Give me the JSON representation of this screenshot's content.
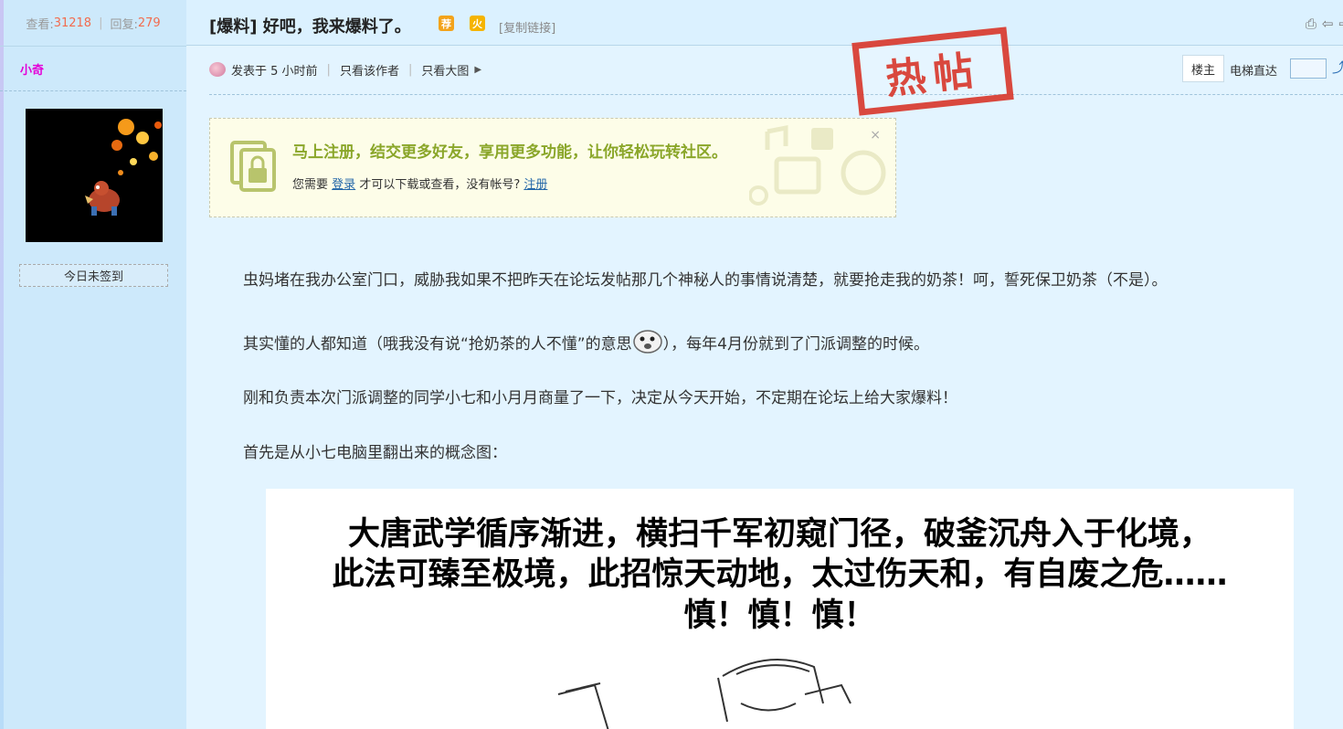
{
  "stats": {
    "views_label": "查看:",
    "views": "31218",
    "replies_label": "回复:",
    "replies": "279"
  },
  "user": {
    "name": "小奇",
    "checkin_label": "今日未签到"
  },
  "thread": {
    "tag": "[爆料]",
    "title": "好吧，我来爆料了。",
    "badge_recommend": "荐",
    "badge_hot": "火",
    "copy_link": "[复制链接]",
    "stamp": "热帖"
  },
  "meta": {
    "posted": "发表于 5 小时前",
    "only_author": "只看该作者",
    "only_big_image": "只看大图",
    "floor": "楼主",
    "jump_label": "电梯直达"
  },
  "register_box": {
    "headline": "马上注册，结交更多好友，享用更多功能，让你轻松玩转社区。",
    "sub_prefix": "您需要",
    "login": "登录",
    "sub_middle": "才可以下载或查看，没有帐号?",
    "register": "注册",
    "close": "×"
  },
  "post": {
    "p1": "虫妈堵在我办公室门口，威胁我如果不把昨天在论坛发帖那几个神秘人的事情说清楚，就要抢走我的奶茶！呵，誓死保卫奶茶（不是）。",
    "p2a": "其实懂的人都知道（哦我没有说“抢奶茶的人不懂”的意思",
    "p2b": "），每年4月份就到了门派调整的时候。",
    "p3": "刚和负责本次门派调整的同学小七和小月月商量了一下，决定从今天开始，不定期在论坛上给大家爆料！",
    "p4": "首先是从小七电脑里翻出来的概念图："
  },
  "concept_image": {
    "line1": "大唐武学循序渐进，横扫千军初窥门径，破釜沉舟入于化境，",
    "line2": "此法可臻至极境，此招惊天动地，太过伤天和，有自废之危……",
    "line3": "慎！慎！慎！"
  },
  "colors": {
    "sidebar_bg": "#cde9fb",
    "page_bg": "#e3f4ff",
    "username": "#e400d8",
    "stat_number": "#f26c4f",
    "headline_green": "#8aa629",
    "link_blue": "#2366a8",
    "stamp_red": "#d9362a"
  }
}
